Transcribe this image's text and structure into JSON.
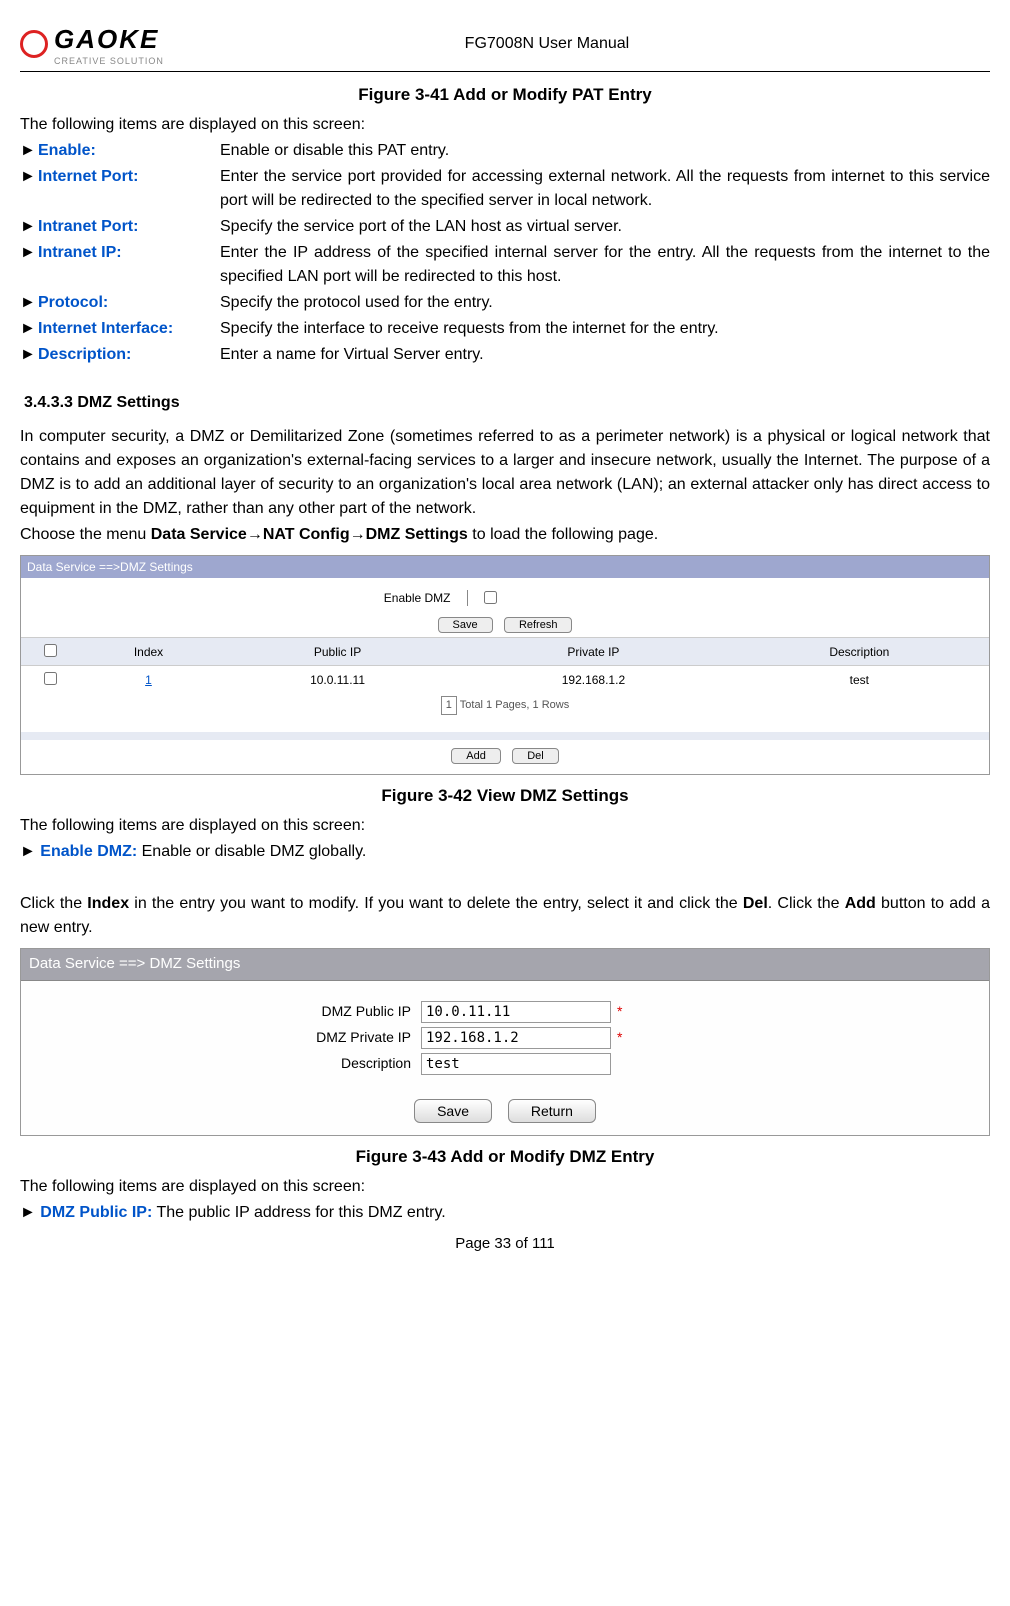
{
  "header": {
    "brand": "GAOKE",
    "brand_sub": "CREATIVE SOLUTION",
    "doc_title": "FG7008N User Manual"
  },
  "fig41": {
    "caption": "Figure 3-41  Add or Modify PAT Entry",
    "intro": "The following items are displayed on this screen:",
    "defs": [
      {
        "label": "Enable:",
        "desc": "Enable or disable this PAT entry."
      },
      {
        "label": "Internet Port:",
        "desc": "Enter the service port provided for accessing external network. All the requests from internet to this service port will be redirected to the specified server in local network."
      },
      {
        "label": "Intranet Port:",
        "desc": "Specify the service port of the LAN host as virtual server."
      },
      {
        "label": "Intranet IP:",
        "desc": "Enter the IP address of the specified internal server for the entry. All the requests from the internet to the specified LAN port will be redirected to this host."
      },
      {
        "label": "Protocol:",
        "desc": "Specify the protocol used for the entry."
      },
      {
        "label": "Internet Interface:",
        "desc": "Specify the interface to receive requests from the internet for the entry."
      },
      {
        "label": "Description:",
        "desc": "Enter a name for Virtual Server entry."
      }
    ]
  },
  "sec3433": {
    "heading": "3.4.3.3      DMZ Settings",
    "para": "In computer security, a DMZ or Demilitarized Zone (sometimes referred to as a perimeter network) is a physical or logical network that contains and exposes an organization's external-facing services to a larger and insecure network, usually the Internet. The purpose of a DMZ is to add an additional layer of security to an organization's local area network (LAN); an external attacker only has direct access to equipment in the DMZ, rather than any other part of the network.",
    "nav_pre": "Choose the menu ",
    "nav_b1": "Data Service",
    "nav_arrow": "→",
    "nav_b2": "NAT Config",
    "nav_b3": "DMZ Settings",
    "nav_post": " to load the following page."
  },
  "shot1": {
    "breadcrumb": "Data Service ==>DMZ Settings",
    "enable_label": "Enable DMZ",
    "btn_save": "Save",
    "btn_refresh": "Refresh",
    "cols": [
      "Index",
      "Public IP",
      "Private IP",
      "Description"
    ],
    "row": {
      "index": "1",
      "public": "10.0.11.11",
      "private": "192.168.1.2",
      "desc": "test"
    },
    "pager_num": "1",
    "pager_text": " Total 1 Pages, 1 Rows",
    "btn_add": "Add",
    "btn_del": "Del"
  },
  "fig42": {
    "caption": "Figure 3-42  View DMZ Settings",
    "intro": "The following items are displayed on this screen:",
    "def1_label": "Enable DMZ:",
    "def1_desc": " Enable or disable DMZ globally.",
    "para2_pre": "Click the ",
    "para2_b1": "Index",
    "para2_mid": " in the entry you want to modify. If you want to delete the entry, select it and click the ",
    "para2_b2": "Del",
    "para2_post": ". Click the ",
    "para2_b3": "Add",
    "para2_end": " button to add a new entry."
  },
  "shot2": {
    "breadcrumb": "Data Service ==> DMZ Settings",
    "fields": [
      {
        "label": "DMZ Public IP",
        "value": "10.0.11.11",
        "req": true
      },
      {
        "label": "DMZ Private IP",
        "value": "192.168.1.2",
        "req": true
      },
      {
        "label": "Description",
        "value": "test",
        "req": false
      }
    ],
    "btn_save": "Save",
    "btn_return": "Return"
  },
  "fig43": {
    "caption": "Figure 3-43  Add or Modify DMZ Entry",
    "intro": "The following items are displayed on this screen:",
    "def1_label": "DMZ Public IP:",
    "def1_desc": "   The public IP address for this DMZ entry."
  },
  "footer": "Page 33 of 111",
  "arrow": "►"
}
